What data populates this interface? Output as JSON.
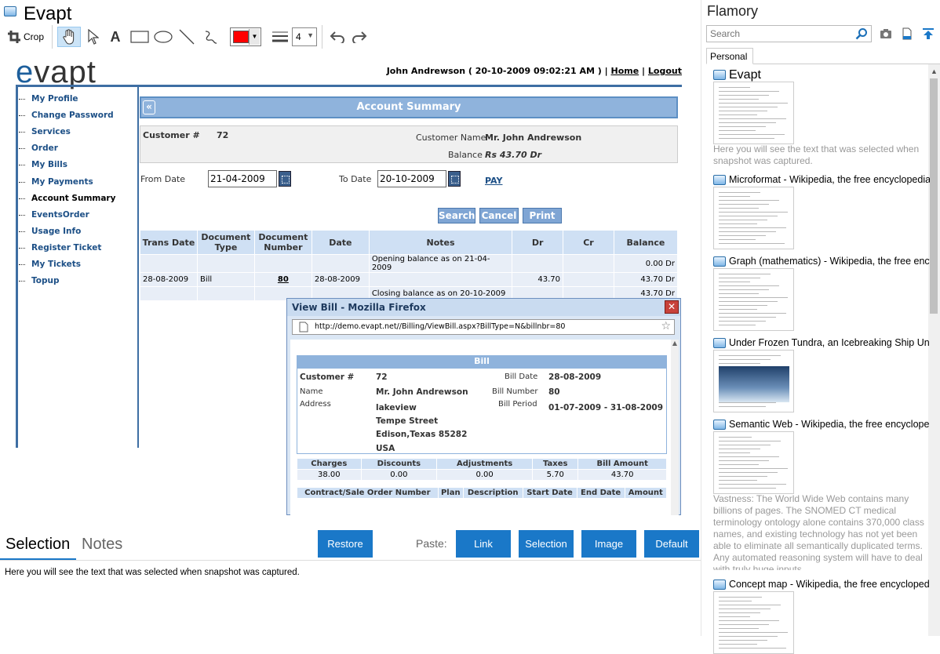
{
  "window": {
    "title": "Evapt"
  },
  "toolbar": {
    "crop_label": "Crop",
    "line_width": "4",
    "stroke_color": "#ff0000"
  },
  "snapshot": {
    "logo": {
      "part1": "e",
      "part2": "vapt"
    },
    "user_line": {
      "name_date": "John Andrewson ( 20-10-2009 09:02:21 AM ) |",
      "home": "Home",
      "sep": "|",
      "logout": "Logout"
    },
    "nav": [
      "My Profile",
      "Change Password",
      "Services",
      "Order",
      "My Bills",
      "My Payments",
      "Account Summary",
      "EventsOrder",
      "Usage Info",
      "Register Ticket",
      "My Tickets",
      "Topup"
    ],
    "account_summary": {
      "title": "Account Summary",
      "back_glyph": "«",
      "customer_label": "Customer #",
      "customer_no": "72",
      "customer_name_label": "Customer Name",
      "customer_name": "Mr. John Andrewson",
      "balance_label": "Balance",
      "balance": "Rs 43.70 Dr",
      "from_date_label": "From Date",
      "from_date": "21-04-2009",
      "to_date_label": "To Date",
      "to_date": "20-10-2009",
      "pay_link": "PAY",
      "buttons": {
        "search": "Search",
        "cancel": "Cancel",
        "print": "Print"
      },
      "table": {
        "headers": [
          "Trans Date",
          "Document Type",
          "Document Number",
          "Date",
          "Notes",
          "Dr",
          "Cr",
          "Balance"
        ],
        "rows": [
          [
            "",
            "",
            "",
            "",
            "Opening balance as on 21-04-2009",
            "",
            "",
            "0.00 Dr"
          ],
          [
            "28-08-2009",
            "Bill",
            "80",
            "28-08-2009",
            "",
            "43.70",
            "",
            "43.70 Dr"
          ],
          [
            "",
            "",
            "",
            "",
            "Closing balance as on 20-10-2009",
            "",
            "",
            "43.70 Dr"
          ]
        ]
      }
    },
    "popup": {
      "title": "View Bill - Mozilla Firefox",
      "url": "http://demo.evapt.net//Billing/ViewBill.aspx?BillType=N&billnbr=80",
      "bill_title": "Bill",
      "customer_label": "Customer #",
      "customer_no": "72",
      "name_label": "Name",
      "name": "Mr. John Andrewson",
      "address_label": "Address",
      "address": [
        "lakeview",
        "Tempe Street",
        "Edison,Texas 85282",
        "USA"
      ],
      "bill_date_label": "Bill Date",
      "bill_date": "28-08-2009",
      "bill_number_label": "Bill Number",
      "bill_number": "80",
      "bill_period_label": "Bill Period",
      "bill_period": "01-07-2009 - 31-08-2009",
      "charges_table": {
        "headers": [
          "Charges",
          "Discounts",
          "Adjustments",
          "Taxes",
          "Bill Amount"
        ],
        "values": [
          "38.00",
          "0.00",
          "0.00",
          "5.70",
          "43.70"
        ]
      },
      "detail_headers": [
        "Contract/Sale Order Number",
        "Plan",
        "Description",
        "Start Date",
        "End Date",
        "Amount"
      ]
    }
  },
  "bottom": {
    "tabs": {
      "selection": "Selection",
      "notes": "Notes"
    },
    "restore": "Restore",
    "paste_label": "Paste:",
    "paste_buttons": {
      "link": "Link",
      "selection": "Selection",
      "image": "Image",
      "default": "Default"
    },
    "selection_text": "Here you will see the text that was selected when snapshot was captured."
  },
  "flamory": {
    "title": "Flamory",
    "search_placeholder": "Search",
    "tab": "Personal",
    "items": [
      {
        "title": "Evapt",
        "desc": "Here you will see the text that was selected when snapshot was captured."
      },
      {
        "title": "Microformat - Wikipedia, the free encyclopedia",
        "desc": ""
      },
      {
        "title": "Graph (mathematics) - Wikipedia, the free encyclopedia",
        "desc": ""
      },
      {
        "title": "Under Frozen Tundra, an Icebreaking Ship Uncovers",
        "desc": ""
      },
      {
        "title": "Semantic Web - Wikipedia, the free encyclopedia",
        "desc": "Vastness: The World Wide Web contains many billions of pages. The SNOMED CT medical terminology ontology alone contains 370,000 class names, and existing technology has not yet been able to eliminate all semantically duplicated terms. Any automated reasoning system will have to deal with truly huge inputs."
      },
      {
        "title": "Concept map - Wikipedia, the free encyclopedia",
        "desc": ""
      }
    ]
  }
}
